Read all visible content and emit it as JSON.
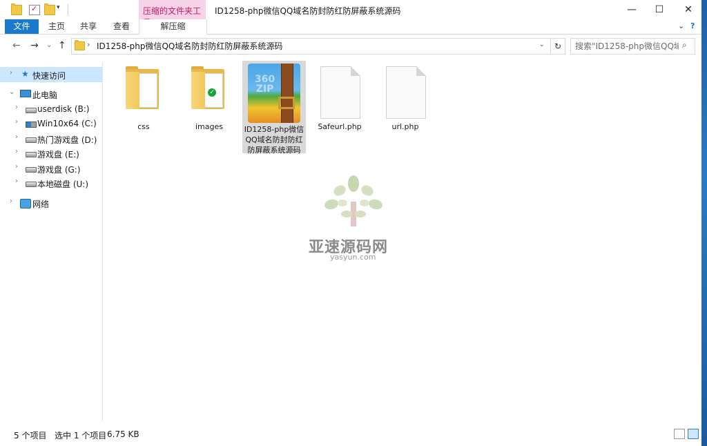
{
  "window": {
    "title": "ID1258-php微信QQ域名防封防红防屏蔽系统源码",
    "contextual_tab_header": "压缩的文件夹工具",
    "controls": {
      "minimize": "—",
      "maximize": "☐",
      "close": "✕"
    }
  },
  "ribbon": {
    "tabs": [
      "文件",
      "主页",
      "共享",
      "查看"
    ],
    "contextual_tab": "解压缩",
    "collapse_glyph": "⌄",
    "help_glyph": "?"
  },
  "address": {
    "path": "ID1258-php微信QQ域名防封防红防屏蔽系统源码",
    "search_placeholder": "搜索\"ID1258-php微信QQ域...",
    "nav_glyphs": {
      "back": "←",
      "forward": "→",
      "recent": "⌄",
      "up": "↑",
      "separator": "›",
      "dropdown": "⌄",
      "refresh": "↻",
      "search": "⌕"
    }
  },
  "navpane": {
    "quick_access": "快速访问",
    "this_pc": "此电脑",
    "drives": [
      {
        "label": "userdisk (B:)",
        "icon": "drive-icon"
      },
      {
        "label": "Win10x64 (C:)",
        "icon": "windows-drive-icon"
      },
      {
        "label": "热门游戏盘 (D:)",
        "icon": "drive-icon"
      },
      {
        "label": "游戏盘 (E:)",
        "icon": "drive-icon"
      },
      {
        "label": "游戏盘 (G:)",
        "icon": "drive-icon"
      },
      {
        "label": "本地磁盘 (U:)",
        "icon": "drive-icon"
      }
    ],
    "network": "网络"
  },
  "files": [
    {
      "name": "css",
      "type": "folder"
    },
    {
      "name": "images",
      "type": "folder"
    },
    {
      "name": "ID1258-php微信QQ域名防封防红防屏蔽系统源码",
      "type": "zip",
      "selected": true,
      "lines": [
        "ID1258-php微信",
        "QQ域名防封防红",
        "防屏蔽系统源码"
      ]
    },
    {
      "name": "Safeurl.php",
      "type": "php"
    },
    {
      "name": "url.php",
      "type": "php"
    }
  ],
  "zip_icon_text": [
    "360",
    "ZIP"
  ],
  "watermark": {
    "title": "亚速源码网",
    "subtitle": "yasyun.com"
  },
  "status": {
    "item_count": "5 个项目",
    "selection": "选中 1 个项目",
    "size": "6.75 KB"
  },
  "colors": {
    "accent": "#1979ca",
    "selection": "#cce8ff",
    "context_tab": "#f6d3e8",
    "context_tab_text": "#c2185b"
  }
}
